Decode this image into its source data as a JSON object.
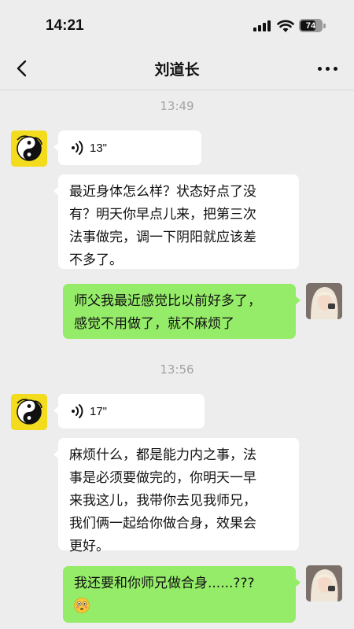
{
  "status_bar": {
    "time": "14:21",
    "battery_label": "74",
    "battery_level_percent": 74,
    "signal_icon": "cellular-signal-icon",
    "wifi_icon": "wifi-icon"
  },
  "header": {
    "title": "刘道长",
    "back_icon": "chevron-left-icon",
    "more_icon": "more-horizontal-icon"
  },
  "messages": [
    {
      "type": "timestamp",
      "text": "13:49"
    },
    {
      "type": "voice",
      "sender": "other",
      "duration": "13\""
    },
    {
      "type": "text",
      "sender": "other",
      "lines": [
        "最近身体怎么样？状态好点了没",
        "有？明天你早点儿来，把第三次",
        "法事做完，调一下阴阳就应该差",
        "不多了。"
      ]
    },
    {
      "type": "text",
      "sender": "self",
      "lines": [
        "师父我最近感觉比以前好多了，",
        "感觉不用做了，就不麻烦了"
      ]
    },
    {
      "type": "timestamp",
      "text": "13:56"
    },
    {
      "type": "voice",
      "sender": "other",
      "duration": "17\""
    },
    {
      "type": "text",
      "sender": "other",
      "lines": [
        "麻烦什么，都是能力内之事，法",
        "事是必须要做完的，你明天一早",
        "来我这儿，我带你去见我师兄，",
        "我们俩一起给你做合身，效果会",
        "更好。"
      ]
    },
    {
      "type": "text",
      "sender": "self",
      "lines": [
        "我还要和你师兄做合身......???"
      ],
      "emoji": "flushed-face-emoji"
    }
  ],
  "colors": {
    "background": "#ededed",
    "bubble_in": "#ffffff",
    "bubble_out": "#95ec69",
    "timestamp": "#a3a3a3",
    "avatar_taoist_bg": "#f2dc1d"
  }
}
